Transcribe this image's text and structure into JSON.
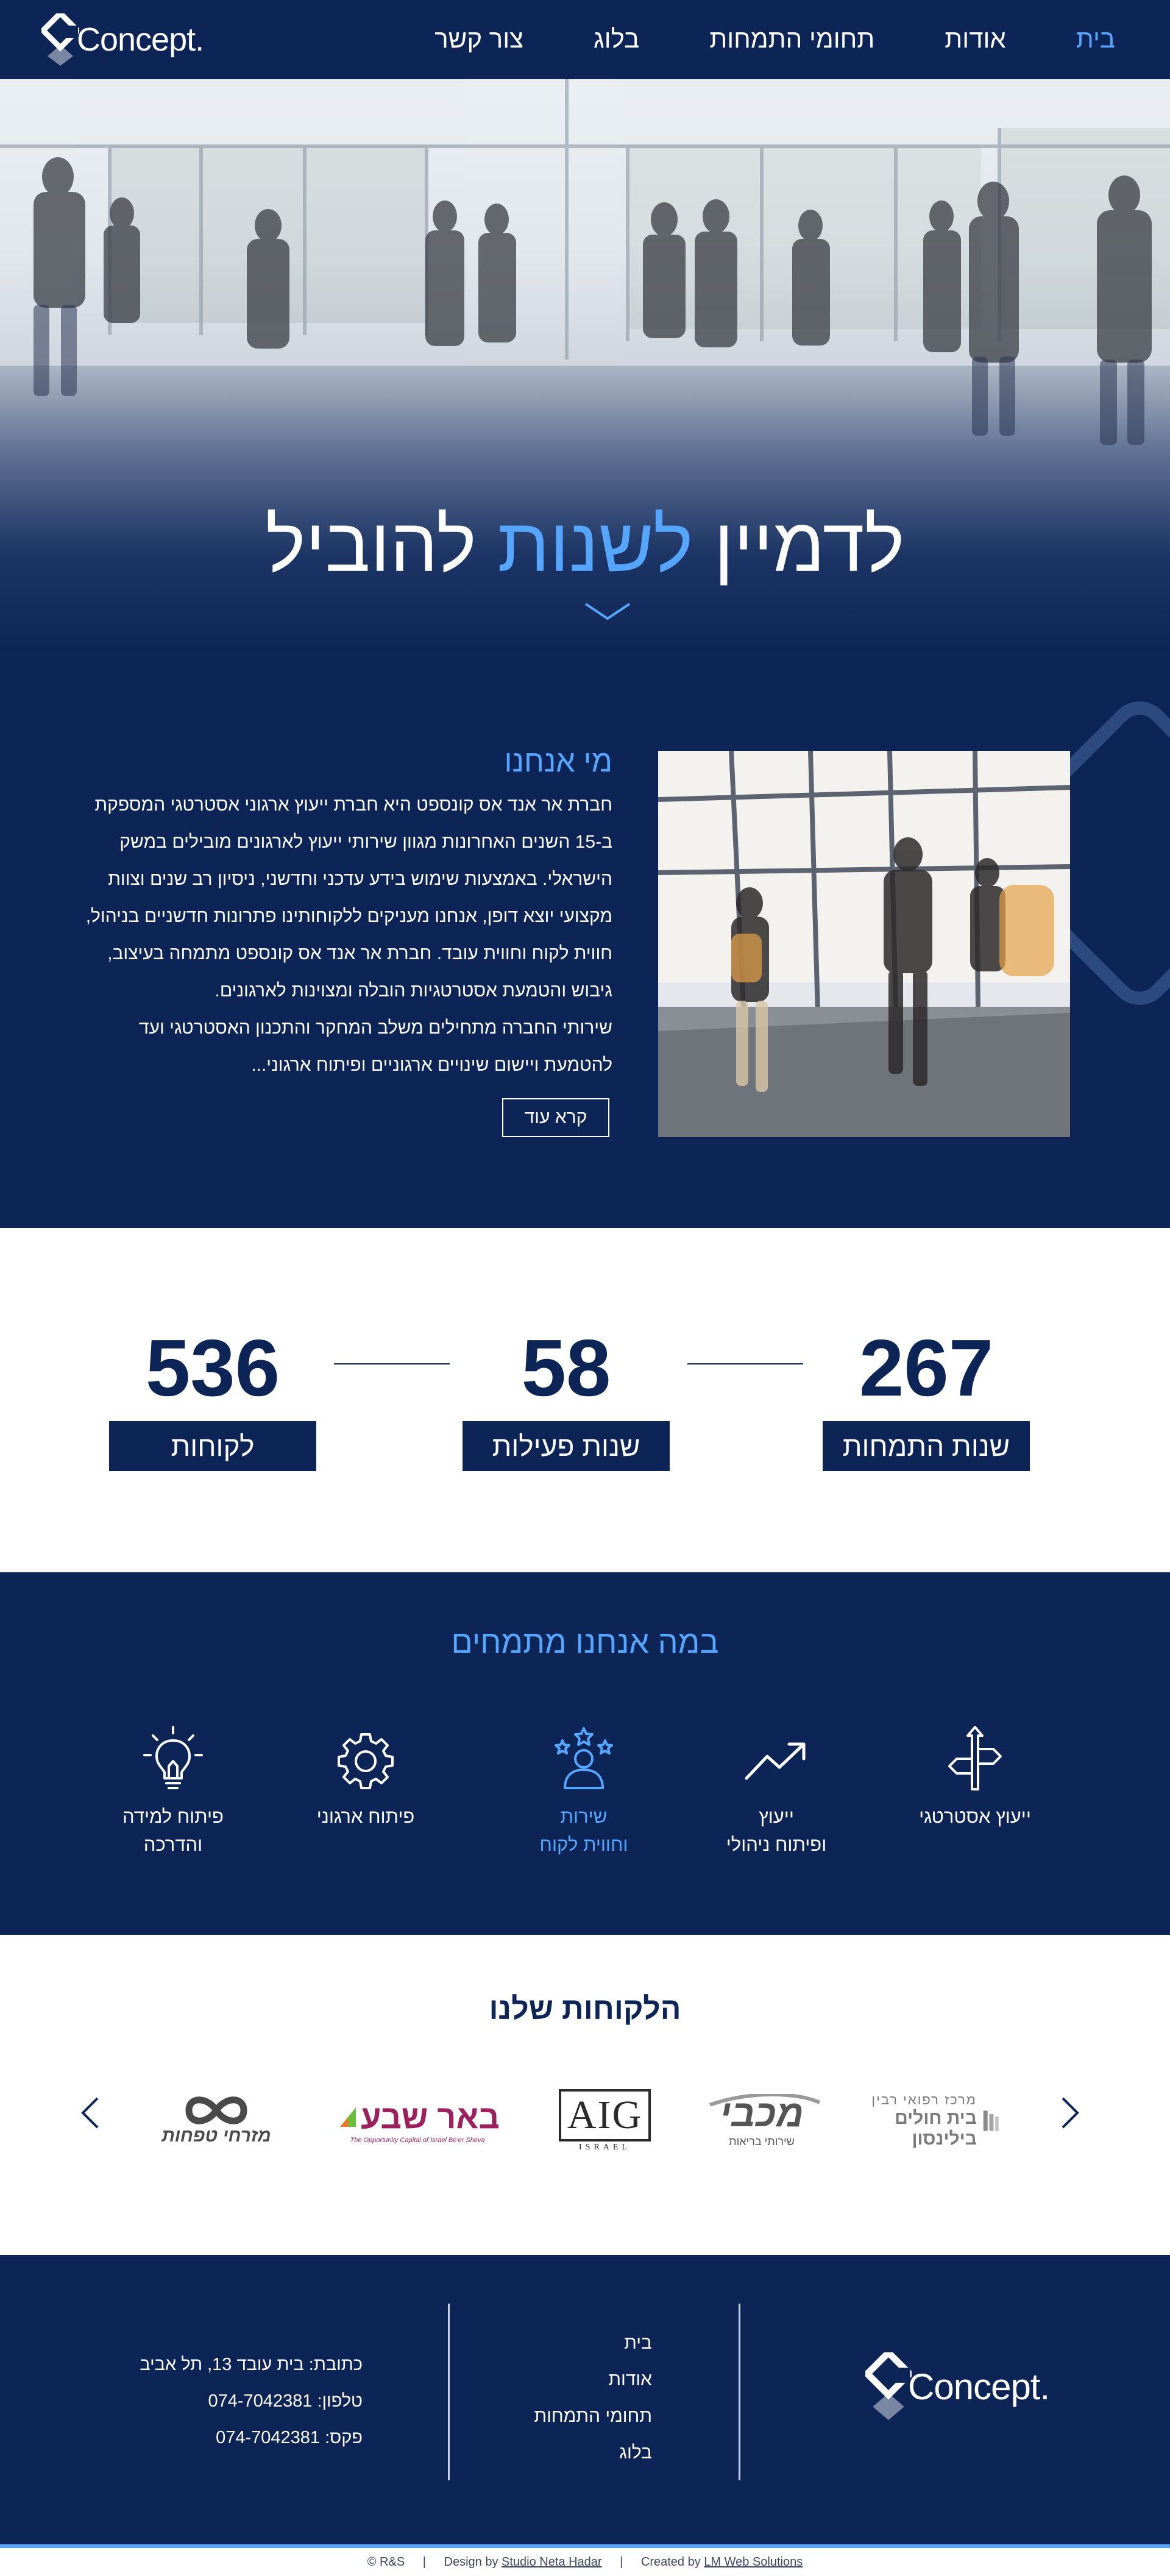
{
  "nav": {
    "logo_text": "Concept.",
    "links": [
      {
        "label": "בית"
      },
      {
        "label": "אודות"
      },
      {
        "label": "תחומי התמחות"
      },
      {
        "label": "בלוג"
      },
      {
        "label": "צור קשר"
      }
    ]
  },
  "hero": {
    "title_part1": "לדמיין",
    "title_accent": "לשנות",
    "title_part2": "להוביל",
    "scroll_icon": "chevron-down-icon"
  },
  "about": {
    "heading": "מי אנחנו",
    "paragraphs": [
      "חברת אר אנד אס קונספט היא חברת ייעוץ ארגוני אסטרטגי המספקת ב-15 השנים האחרונות מגוון שירותי ייעוץ לארגונים מובילים במשק הישראלי. באמצעות שימוש בידע עדכני וחדשני, ניסיון רב שנים וצוות מקצועי יוצא דופן, אנחנו מעניקים ללקוחותינו פתרונות חדשניים בניהול, חווית לקוח וחווית עובד. חברת אר אנד אס קונספט מתמחה בעיצוב, גיבוש והטמעת אסטרטגיות הובלה ומצוינות לארגונים.",
      "שירותי החברה מתחילים משלב המחקר והתכנון האסטרטגי ועד להטמעת ויישום שינויים ארגוניים ופיתוח ארגוני..."
    ],
    "read_more": "קרא עוד"
  },
  "stats": [
    {
      "number": "267",
      "label": "שנות התמחות"
    },
    {
      "number": "58",
      "label": "שנות פעילות"
    },
    {
      "number": "536",
      "label": "לקוחות"
    }
  ],
  "services": {
    "title": "במה אנחנו מתמחים",
    "items": [
      {
        "line1": "ייעוץ אסטרטגי",
        "line2": "",
        "icon": "signpost-icon"
      },
      {
        "line1": "ייעוץ",
        "line2": "ופיתוח ניהולי",
        "icon": "trending-up-icon"
      },
      {
        "line1": "שירות",
        "line2": "וחווית לקוח",
        "icon": "customer-stars-icon"
      },
      {
        "line1": "פיתוח ארגוני",
        "line2": "",
        "icon": "gear-icon"
      },
      {
        "line1": "פיתוח למידה",
        "line2": "והדרכה",
        "icon": "lightbulb-icon"
      }
    ]
  },
  "clients": {
    "title": "הלקוחות שלנו",
    "logos": [
      {
        "name": "בית חולים בילינסון",
        "subtitle": "מרכז רפואי רבין"
      },
      {
        "name": "מכבי",
        "subtitle": "שירותי בריאות"
      },
      {
        "name": "AIG",
        "subtitle": "ISRAEL"
      },
      {
        "name": "באר שבע",
        "subtitle": "The Opportunity Capital of Israel  Be'er Sheva"
      },
      {
        "name": "מזרחי טפחות",
        "subtitle": ""
      }
    ]
  },
  "footer": {
    "logo_text": "Concept.",
    "menu": [
      "בית",
      "אודות",
      "תחומי התמחות",
      "בלוג"
    ],
    "address": "כתובת: בית עובד 13, תל אביב",
    "phone": "טלפון: 074-7042381",
    "fax": "פקס: 074-7042381"
  },
  "credits": {
    "copyright": "© R&S",
    "design_prefix": "Design by",
    "design_link": "Studio Neta Hadar",
    "created_prefix": "Created by",
    "created_link": "LM Web Solutions"
  },
  "colors": {
    "navy": "#0c2556",
    "accent_blue": "#56a6ff",
    "white": "#ffffff"
  }
}
